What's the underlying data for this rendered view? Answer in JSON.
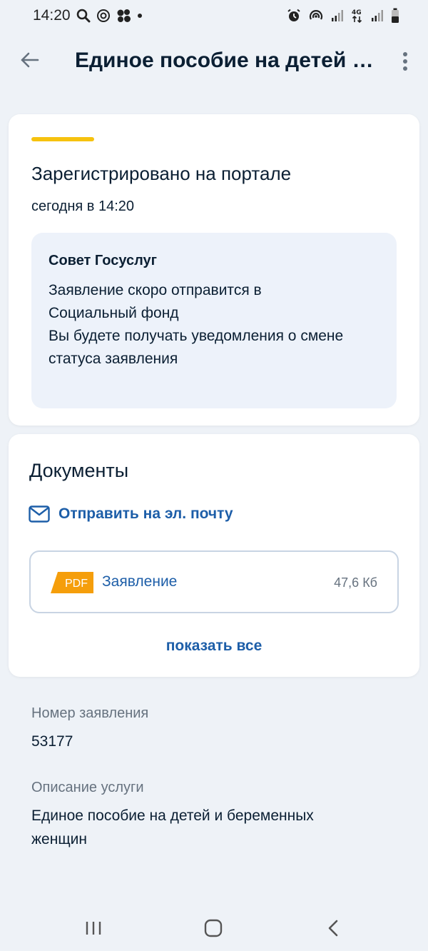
{
  "status_bar": {
    "time": "14:20",
    "left_icons": [
      "search-icon",
      "target-icon",
      "cluster-icon",
      "dot-icon"
    ],
    "right_icons": [
      "alarm-icon",
      "hotspot-icon",
      "signal-icon",
      "network-4g-icon",
      "signal-icon",
      "battery-icon"
    ],
    "network_label": "4G"
  },
  "header": {
    "title": "Единое пособие на детей и беременных женщин",
    "back_icon": "arrow-left-icon",
    "menu_icon": "more-vertical-icon"
  },
  "status_card": {
    "accent_color": "#f6c20e",
    "title": "Зарегистрировано на портале",
    "time": "сегодня в 14:20",
    "advice": {
      "title": "Совет Госуслуг",
      "lines": [
        "Заявление скоро отправится в",
        "Социальный фонд",
        "Вы будете получать уведомления о смене",
        "статуса заявления"
      ]
    }
  },
  "documents_card": {
    "title": "Документы",
    "email_link": "Отправить на эл. почту",
    "files": [
      {
        "badge": "PDF",
        "name": "Заявление",
        "size": "47,6 Кб"
      }
    ],
    "show_all": "показать все"
  },
  "details": {
    "number_label": "Номер заявления",
    "number_value": "53177",
    "description_label": "Описание услуги",
    "description_lines": [
      "Единое пособие на детей и беременных",
      "женщин"
    ]
  },
  "colors": {
    "background": "#eef2f7",
    "link": "#1d5ea8",
    "pdf_badge": "#f59e0b",
    "advice_bg": "#edf2fa"
  },
  "nav_bar": {
    "icons": [
      "recent-apps-icon",
      "home-icon",
      "back-icon"
    ]
  }
}
